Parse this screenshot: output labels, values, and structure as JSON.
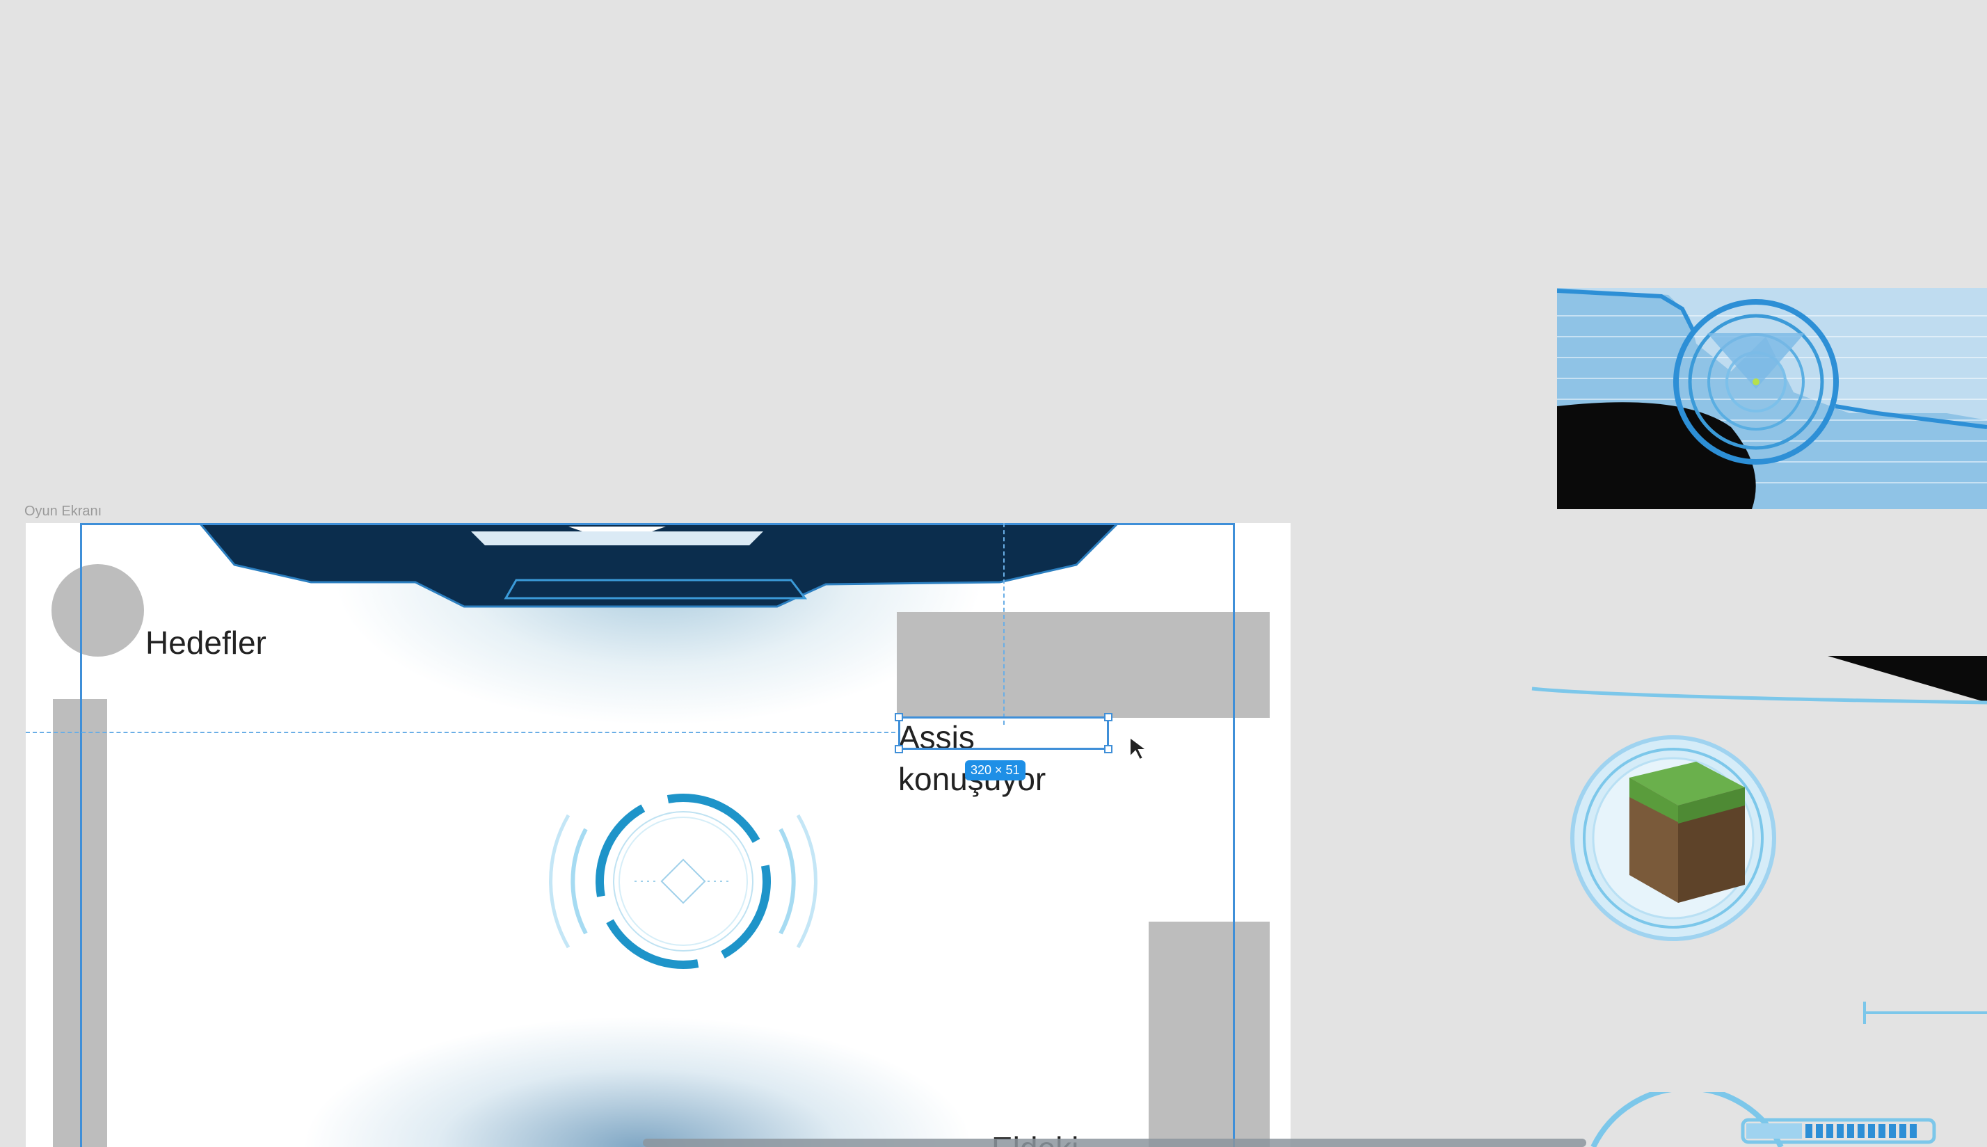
{
  "canvas": {
    "frame_label": "Oyun Ekranı",
    "goals_label": "Hedefler",
    "assistant_text_line1": "Assis",
    "assistant_text_line2": "konuşuyor",
    "selection_size": "320 × 51",
    "bottom_peek_label": "Eldeki"
  },
  "colors": {
    "canvas_bg": "#e3e3e3",
    "selection": "#3f8fd8",
    "hud_dark": "#0b2d4d",
    "hud_light": "#7cc7ea",
    "placeholder_gray": "#bdbdbd"
  },
  "assets": {
    "thumb1": "radar-hud-panel",
    "thumb2": "hud-line-wedge",
    "thumb3": "grass-block-badge-icon",
    "thumb4": "slider-handle-icon",
    "thumb5": "hud-progress-meter"
  }
}
